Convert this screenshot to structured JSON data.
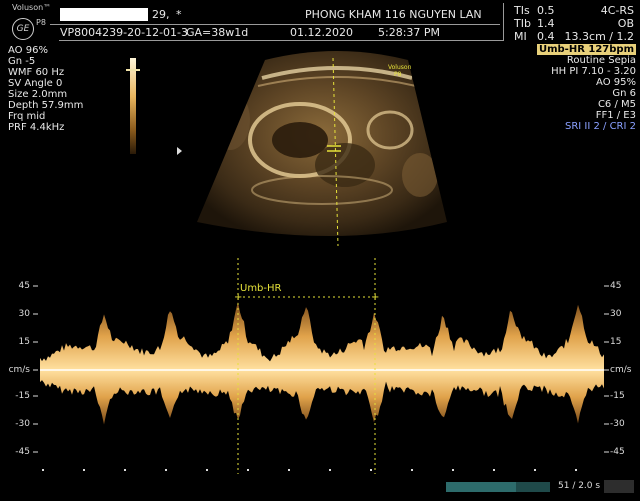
{
  "header": {
    "brand": "Voluson",
    "brand_tm": "™",
    "model": "P8",
    "logo_mark": "GE",
    "patient_age": "29,",
    "patient_sex": "*",
    "clinic": "PHONG KHAM 116 NGUYEN LAN",
    "patient_id": "VP8004239-20-12-01-3",
    "ga": "GA=38w1d",
    "date": "01.12.2020",
    "time": "5:28:37 PM",
    "tis_label": "TIs",
    "tis_value": "0.5",
    "tib_label": "TIb",
    "tib_value": "1.4",
    "mi_label": "MI",
    "mi_value": "0.4",
    "probe": "4C-RS",
    "application": "OB",
    "depth_zoom": "13.3cm / 1.2"
  },
  "left_params": [
    "AO 96%",
    "Gn  -5",
    "WMF 60 Hz",
    "SV Angle  0",
    "Size  2.0mm",
    "Depth 57.9mm",
    "Frq mid",
    "PRF  4.4kHz"
  ],
  "right_params": {
    "measurement_badge": "Umb-HR 127bpm",
    "lines": [
      "Routine Sepia",
      "HH PI 7.10 - 3.20",
      "AO 95%",
      "Gn  6",
      "C6 / M5",
      "FF1 / E3"
    ],
    "sri": "SRI II 2 / CRI 2"
  },
  "image_overlay": {
    "brand": "Voluson",
    "model": "P8"
  },
  "spectral": {
    "caliper_label": "Umb-HR",
    "unit": "cm/s",
    "ticks": [
      "45",
      "30",
      "15",
      "-15",
      "-30",
      "-45"
    ],
    "heart_rate_bpm": 127
  },
  "footer": {
    "frame": "51 / 2.0 s"
  },
  "colors": {
    "sepia": "#e0a24a",
    "caliper": "#e6e23a",
    "badge": "#e8d07a",
    "sri": "#8aa0ff"
  }
}
